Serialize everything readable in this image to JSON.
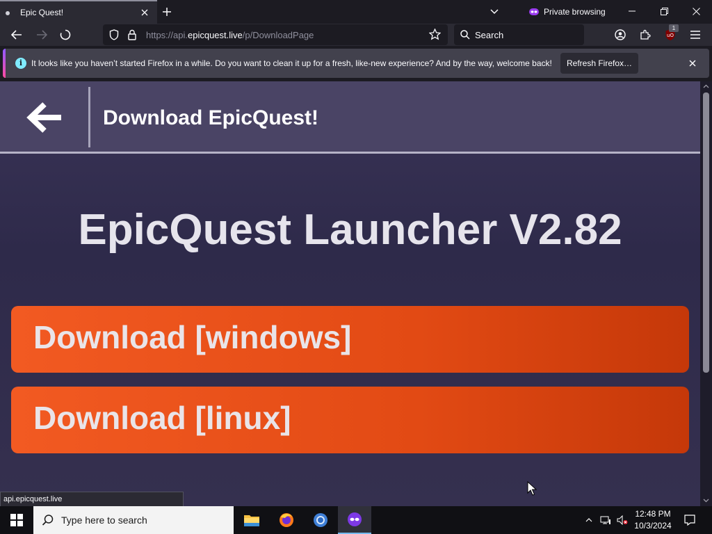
{
  "browser": {
    "tab_title": "Epic Quest!",
    "private_label": "Private browsing",
    "url_prefix": "https://api.",
    "url_host": "epicquest.live",
    "url_path": "/p/DownloadPage",
    "search_label": "Search",
    "extension_badge": "1"
  },
  "notification": {
    "message": "It looks like you haven’t started Firefox in a while. Do you want to clean it up for a fresh, like-new experience? And by the way, welcome back!",
    "button_label": "Refresh Firefox…"
  },
  "page": {
    "header_title": "Download EpicQuest!",
    "launcher_title": "EpicQuest Launcher V2.82",
    "download_windows_label": "Download [windows]",
    "download_linux_label": "Download [linux]"
  },
  "status_bar": {
    "url": "api.epicquest.live"
  },
  "taskbar": {
    "search_placeholder": "Type here to search",
    "time": "12:48 PM",
    "date": "10/3/2024"
  },
  "colors": {
    "button_orange": "#f25a22",
    "page_bg": "#2e2a4a",
    "header_bg": "#4a4465"
  }
}
